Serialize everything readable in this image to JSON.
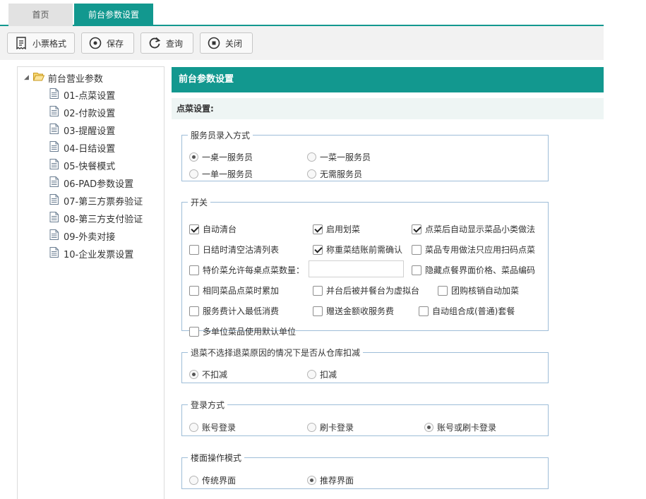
{
  "tabs": {
    "home": "首页",
    "active": "前台参数设置",
    "close": "×"
  },
  "toolbar": {
    "receipt": "小票格式",
    "save": "保存",
    "query": "查询",
    "close": "关闭"
  },
  "tree": {
    "root": "前台营业参数",
    "items": [
      "01-点菜设置",
      "02-付款设置",
      "03-提醒设置",
      "04-日结设置",
      "05-快餐模式",
      "06-PAD参数设置",
      "07-第三方票券验证",
      "08-第三方支付验证",
      "09-外卖对接",
      "10-企业发票设置"
    ]
  },
  "main": {
    "header": "前台参数设置",
    "section": "点菜设置:",
    "waiter": {
      "legend": "服务员录入方式",
      "options": [
        "一桌一服务员",
        "一菜一服务员",
        "一单一服务员",
        "无需服务员"
      ],
      "selected": 0
    },
    "switches": {
      "legend": "开关",
      "items": [
        {
          "label": "自动清台",
          "checked": true
        },
        {
          "label": "启用划菜",
          "checked": true
        },
        {
          "label": "点菜后自动显示菜品小类做法",
          "checked": true
        },
        {
          "label": "日结时清空沽清列表",
          "checked": false
        },
        {
          "label": "称重菜结账前需确认",
          "checked": true
        },
        {
          "label": "菜品专用做法只应用扫码点菜",
          "checked": false
        },
        {
          "label": "特价菜允许每桌点菜数量：",
          "checked": false
        },
        {
          "label": "隐藏点餐界面价格、菜品编码",
          "checked": false
        },
        {
          "label": "相同菜品点菜时累加",
          "checked": false
        },
        {
          "label": "并台后被并餐台为虚拟台",
          "checked": false
        },
        {
          "label": "团购核销自动加菜",
          "checked": false
        },
        {
          "label": "服务费计入最低消费",
          "checked": false
        },
        {
          "label": "赠送金额收服务费",
          "checked": false
        },
        {
          "label": "自动组合成(普通)套餐",
          "checked": false
        },
        {
          "label": "多单位菜品使用默认单位",
          "checked": false
        }
      ],
      "special_qty_value": ""
    },
    "return_deduct": {
      "legend": "退菜不选择退菜原因的情况下是否从仓库扣减",
      "options": [
        "不扣减",
        "扣减"
      ],
      "selected": 0
    },
    "login": {
      "legend": "登录方式",
      "options": [
        "账号登录",
        "刷卡登录",
        "账号或刷卡登录"
      ],
      "selected": 2
    },
    "floor": {
      "legend": "楼面操作模式",
      "options": [
        "传统界面",
        "推荐界面"
      ],
      "selected": 1
    }
  },
  "colors": {
    "accent": "#12988f",
    "section_bg": "#eef5f4",
    "border": "#9ebdd8"
  }
}
